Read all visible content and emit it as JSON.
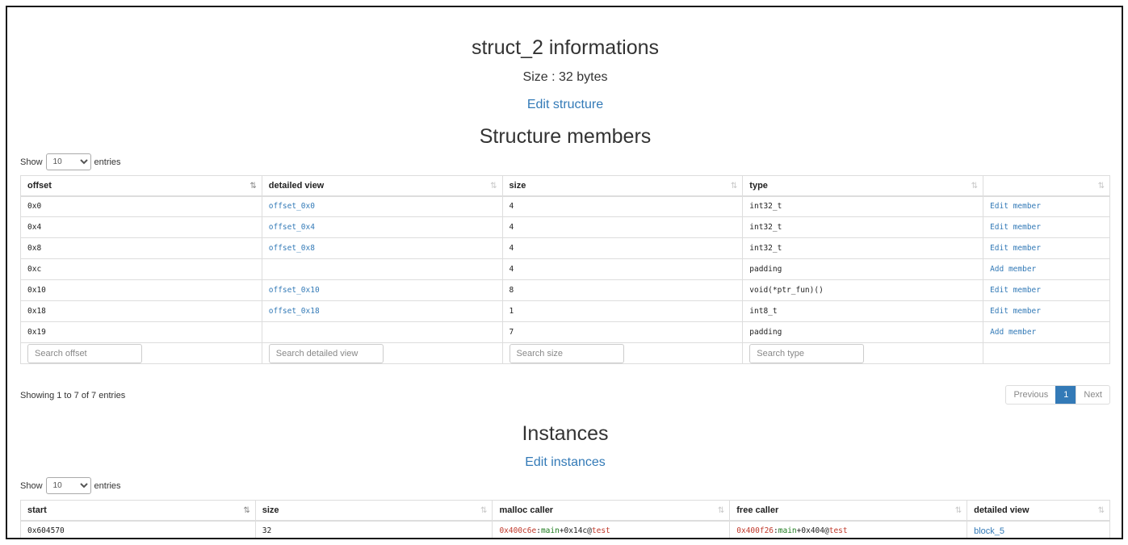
{
  "title": "struct_2 informations",
  "size_text": "Size : 32 bytes",
  "edit_structure": "Edit structure",
  "members": {
    "heading": "Structure members",
    "show_label": "Show",
    "entries_label": "entries",
    "page_size": "10",
    "columns": [
      "offset",
      "detailed view",
      "size",
      "type",
      ""
    ],
    "rows": [
      {
        "offset": "0x0",
        "detail": "offset_0x0",
        "size": "4",
        "type": "int32_t",
        "action": "Edit member"
      },
      {
        "offset": "0x4",
        "detail": "offset_0x4",
        "size": "4",
        "type": "int32_t",
        "action": "Edit member"
      },
      {
        "offset": "0x8",
        "detail": "offset_0x8",
        "size": "4",
        "type": "int32_t",
        "action": "Edit member"
      },
      {
        "offset": "0xc",
        "detail": "",
        "size": "4",
        "type": "padding",
        "action": "Add member"
      },
      {
        "offset": "0x10",
        "detail": "offset_0x10",
        "size": "8",
        "type": "void(*ptr_fun)()",
        "action": "Edit member"
      },
      {
        "offset": "0x18",
        "detail": "offset_0x18",
        "size": "1",
        "type": "int8_t",
        "action": "Edit member"
      },
      {
        "offset": "0x19",
        "detail": "",
        "size": "7",
        "type": "padding",
        "action": "Add member"
      }
    ],
    "search_placeholders": [
      "Search offset",
      "Search detailed view",
      "Search size",
      "Search type"
    ],
    "info": "Showing 1 to 7 of 7 entries",
    "pager": {
      "previous": "Previous",
      "current": "1",
      "next": "Next"
    }
  },
  "instances": {
    "heading": "Instances",
    "edit_link": "Edit instances",
    "show_label": "Show",
    "entries_label": "entries",
    "page_size": "10",
    "columns": [
      "start",
      "size",
      "malloc caller",
      "free caller",
      "detailed view"
    ],
    "rows": [
      {
        "start": "0x604570",
        "size": "32",
        "malloc": {
          "addr": "0x400c6e",
          "sep": ":",
          "func": "main",
          "off": "+0x14c",
          "at": "@",
          "bin": "test"
        },
        "free": {
          "addr": "0x400f26",
          "sep": ":",
          "func": "main",
          "off": "+0x404",
          "at": "@",
          "bin": "test"
        },
        "detail": "block_5"
      }
    ]
  },
  "colors": {
    "link": "#337ab7",
    "type": "#a87a36",
    "addr": "#c0392b",
    "func": "#1e7b1e",
    "page_active": "#337ab7"
  }
}
